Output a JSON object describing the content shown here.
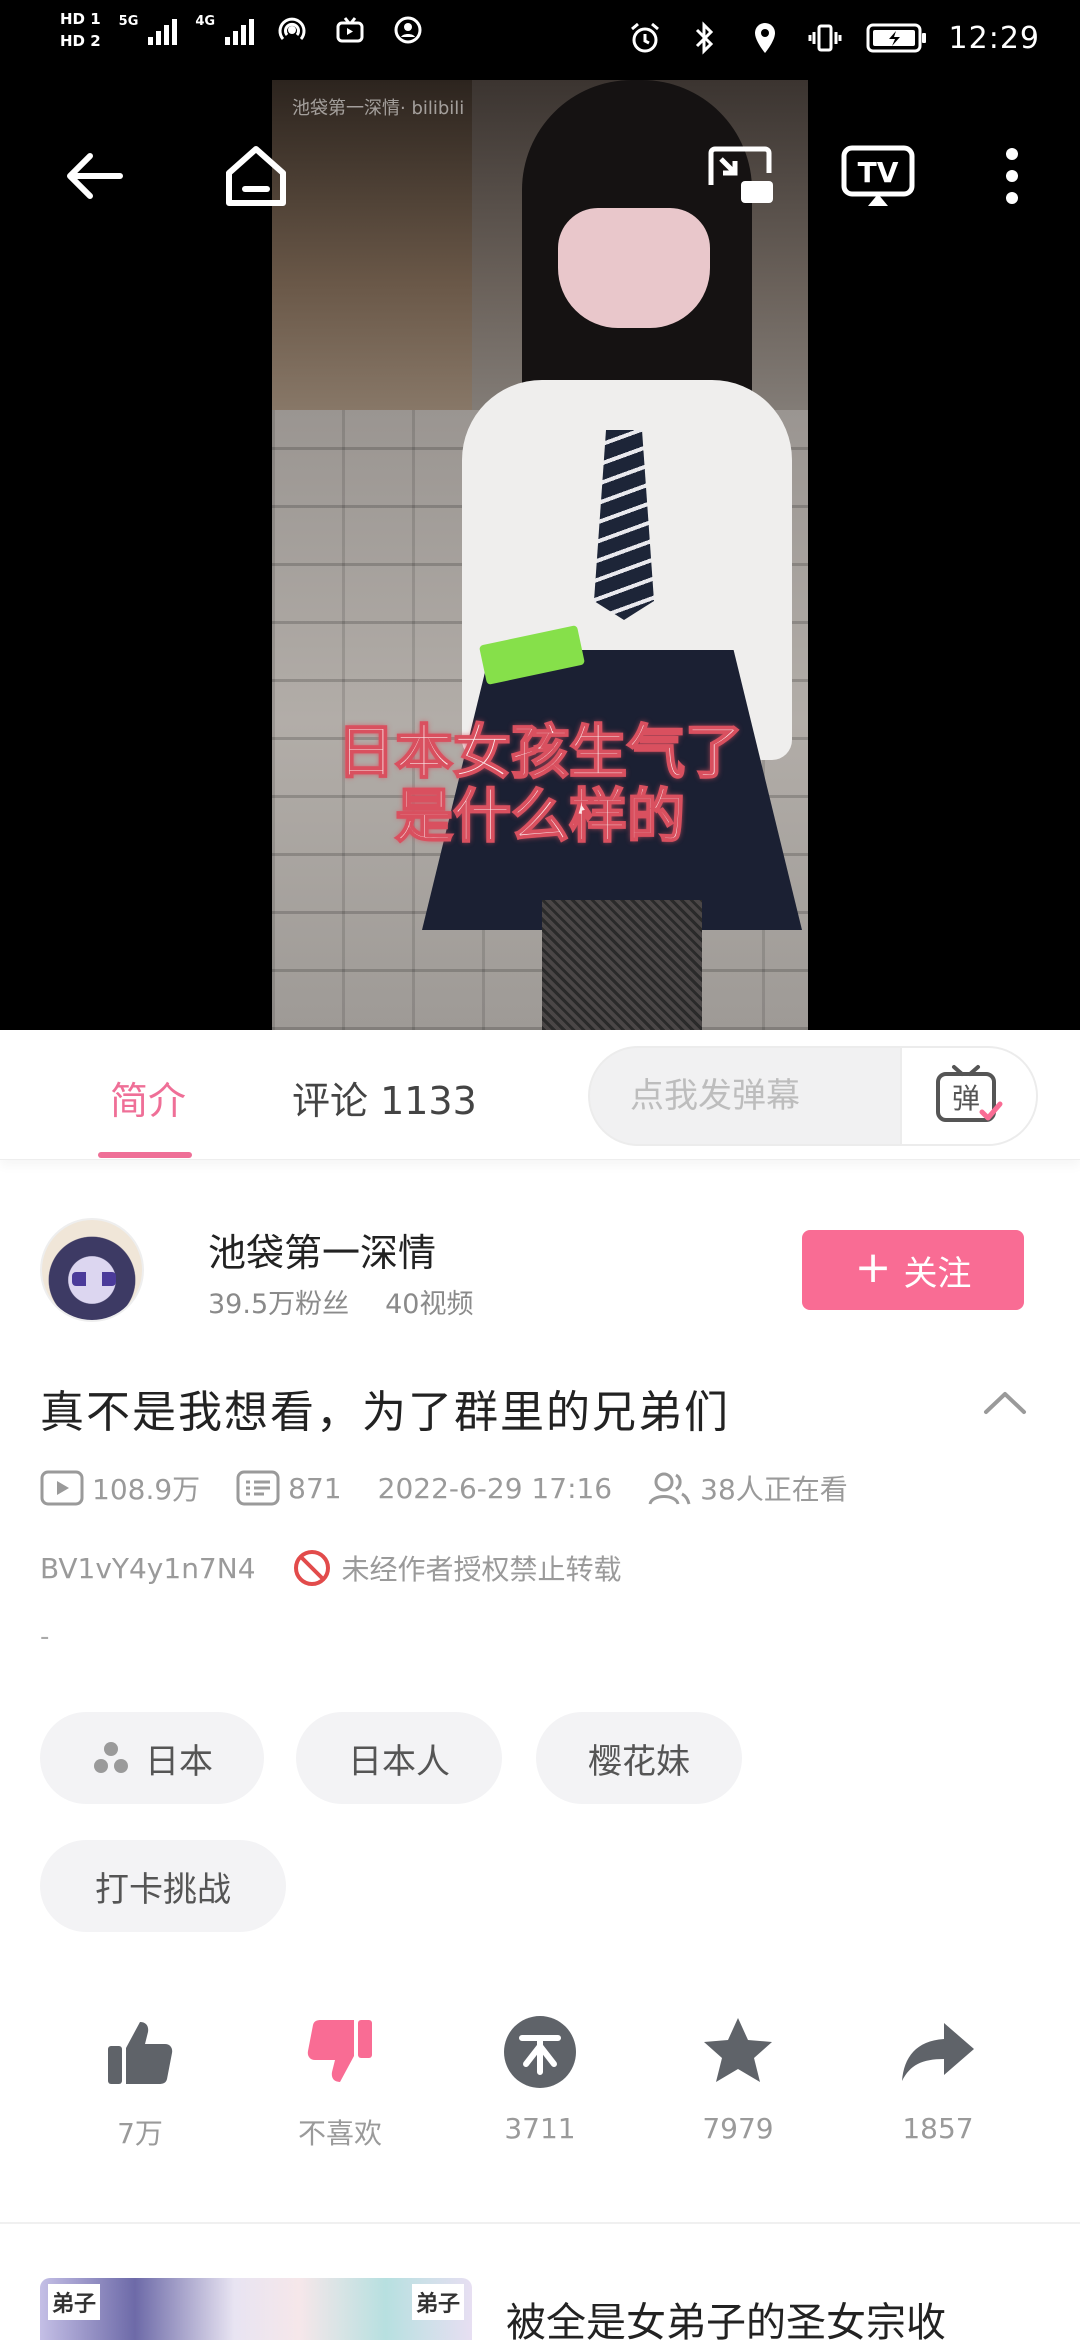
{
  "status_bar": {
    "hd1": "HD 1",
    "hd2": "HD 2",
    "net1": "5G",
    "net2": "4G",
    "time": "12:29"
  },
  "video": {
    "watermark": "池袋第一深情· bilibili",
    "caption_line1": "日本女孩生气了",
    "caption_line2": "是什么样的"
  },
  "tabs": {
    "intro": "简介",
    "comments": "评论 1133"
  },
  "danmaku": {
    "placeholder": "点我发弹幕",
    "button_label": "弹"
  },
  "uploader": {
    "name": "池袋第一深情",
    "fans": "39.5万粉丝",
    "videos": "40视频",
    "follow_label": "关注"
  },
  "video_info": {
    "title": "真不是我想看，为了群里的兄弟们",
    "views": "108.9万",
    "danmaku_count": "871",
    "datetime": "2022-6-29 17:16",
    "watching": "38人正在看",
    "bvid": "BV1vY4y1n7N4",
    "copyright": "未经作者授权禁止转载",
    "description": "-"
  },
  "tags": [
    "日本",
    "日本人",
    "樱花妹",
    "打卡挑战"
  ],
  "actions": {
    "like": "7万",
    "dislike": "不喜欢",
    "coin": "3711",
    "favorite": "7979",
    "share": "1857"
  },
  "recommendation": {
    "badge_left": "弟子",
    "badge_right": "弟子",
    "title": "被全是女弟子的圣女宗收"
  },
  "colors": {
    "accent": "#f96c94",
    "tab_active": "#ef6f97",
    "secondary_text": "#9a9a9a"
  }
}
